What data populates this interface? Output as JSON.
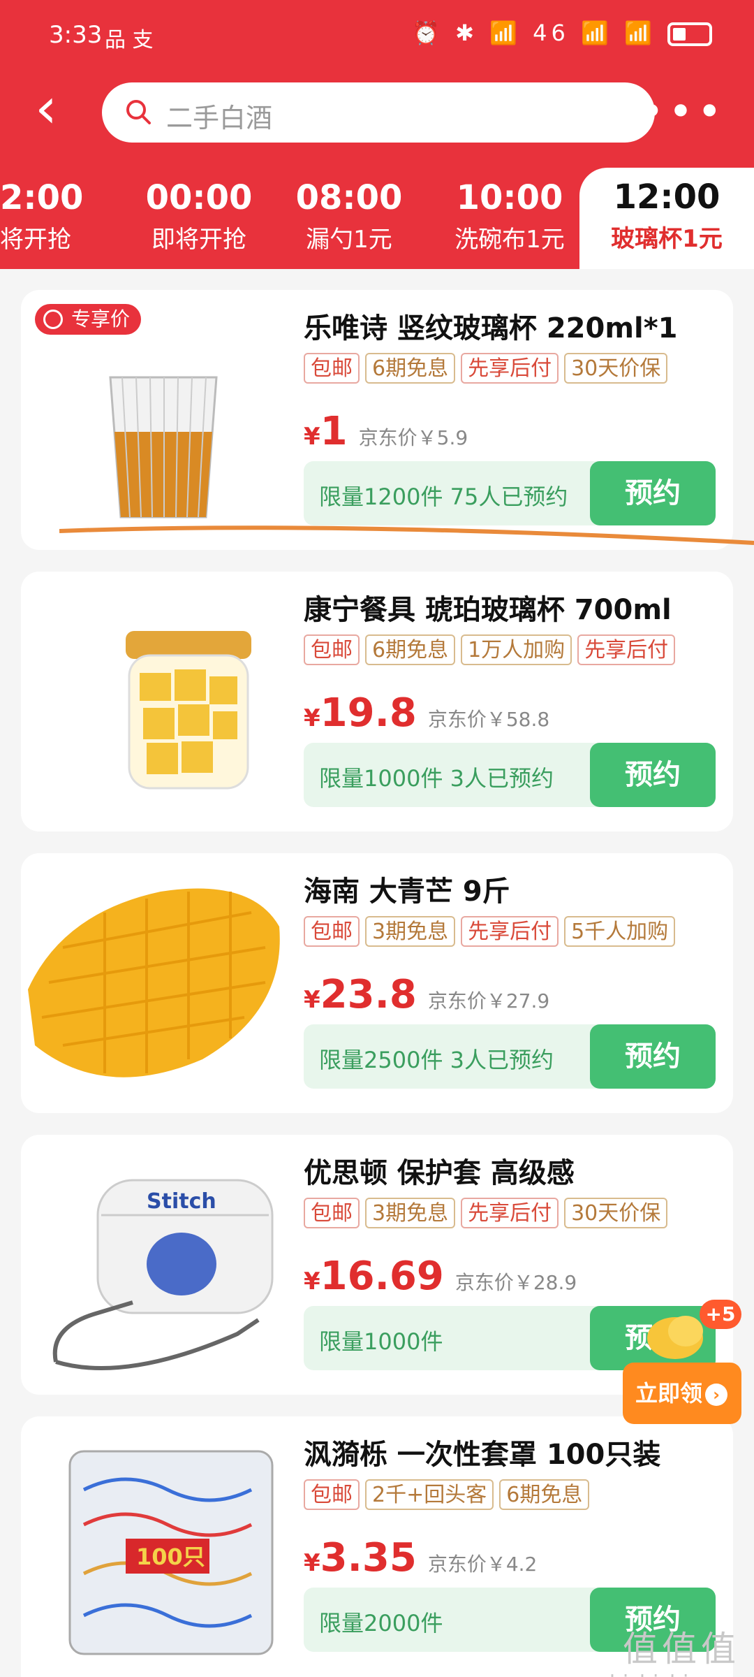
{
  "status": {
    "time": "3:33",
    "app_icons": "品 支",
    "sys_icons": "⏰ ✱ 📶 46 📶 📶"
  },
  "search": {
    "placeholder": "二手白酒"
  },
  "tabs": [
    {
      "time": "2:00",
      "sub": "将开抢"
    },
    {
      "time": "00:00",
      "sub": "即将开抢"
    },
    {
      "time": "08:00",
      "sub": "漏勺1元"
    },
    {
      "time": "10:00",
      "sub": "洗碗布1元"
    },
    {
      "time": "12:00",
      "sub": "玻璃杯1元"
    }
  ],
  "products": [
    {
      "badge": "专享价",
      "title": "乐唯诗 竖纹玻璃杯 220ml*1",
      "tags": [
        "包邮",
        "6期免息",
        "先享后付",
        "30天价保"
      ],
      "price_cur": "¥",
      "price": "1",
      "jd": "京东价￥5.9",
      "limit": "限量1200件 75人已预约",
      "btn": "预约"
    },
    {
      "title": "康宁餐具 琥珀玻璃杯 700ml",
      "tags": [
        "包邮",
        "6期免息",
        "1万人加购",
        "先享后付"
      ],
      "price_cur": "¥",
      "price": "19.8",
      "jd": "京东价￥58.8",
      "limit": "限量1000件 3人已预约",
      "btn": "预约"
    },
    {
      "title": "海南 大青芒 9斤",
      "tags": [
        "包邮",
        "3期免息",
        "先享后付",
        "5千人加购"
      ],
      "price_cur": "¥",
      "price": "23.8",
      "jd": "京东价￥27.9",
      "limit": "限量2500件 3人已预约",
      "btn": "预约"
    },
    {
      "title": "优思顿 保护套 高级感",
      "tags": [
        "包邮",
        "3期免息",
        "先享后付",
        "30天价保"
      ],
      "price_cur": "¥",
      "price": "16.69",
      "jd": "京东价￥28.9",
      "limit": "限量1000件",
      "btn": "预约"
    },
    {
      "title": "沨漪栎 一次性套罩 100只装",
      "tags": [
        "包邮",
        "2千+回头客",
        "6期免息"
      ],
      "price_cur": "¥",
      "price": "3.35",
      "jd": "京东价￥4.2",
      "limit": "限量2000件",
      "btn": "预约"
    }
  ],
  "images": {
    "bag_label": "100只",
    "case_label": "Stitch"
  },
  "float": {
    "plus": "+5",
    "claim": "立即领"
  },
  "watermark": {
    "big": "值值值",
    "small": "zhizhizhi.com"
  }
}
